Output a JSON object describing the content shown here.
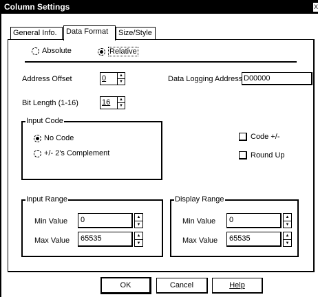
{
  "window": {
    "title": "Column Settings",
    "close_glyph": "X"
  },
  "tabs": [
    {
      "label": "General Info."
    },
    {
      "label": "Data Format"
    },
    {
      "label": "Size/Style"
    }
  ],
  "mode": {
    "absolute_label": "Absolute",
    "relative_label": "Relative",
    "selected": "Relative"
  },
  "address_offset": {
    "label": "Address Offset",
    "value": "0"
  },
  "bit_length": {
    "label": "Bit Length (1-16)",
    "value": "16"
  },
  "data_logging": {
    "label": "Data Logging Address",
    "value": "D00000"
  },
  "input_code": {
    "title": "Input Code",
    "no_code_label": "No Code",
    "twos_label": "+/- 2's Complement",
    "selected": "No Code"
  },
  "options": {
    "code_pm_label": "Code +/-",
    "round_up_label": "Round Up"
  },
  "input_range": {
    "title": "Input Range",
    "min_label": "Min Value",
    "min_value": "0",
    "max_label": "Max Value",
    "max_value": "65535"
  },
  "display_range": {
    "title": "Display Range",
    "min_label": "Min Value",
    "min_value": "0",
    "max_label": "Max Value",
    "max_value": "65535"
  },
  "buttons": {
    "ok": "OK",
    "cancel": "Cancel",
    "help": "Help"
  }
}
